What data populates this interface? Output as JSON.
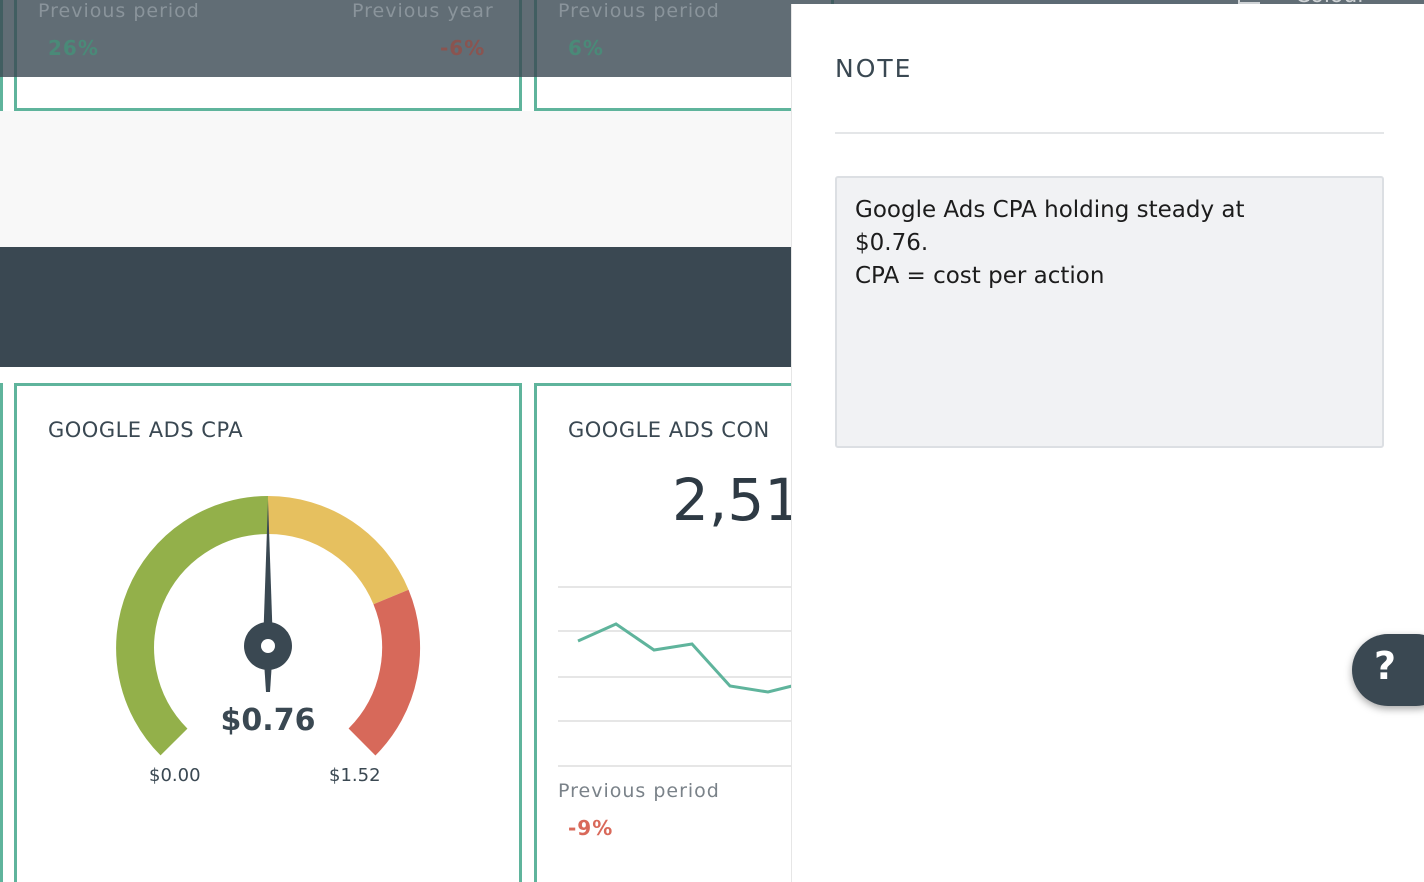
{
  "top_row": {
    "widget_a": {
      "previous_period_label": "Previous period",
      "previous_period_value": "26%",
      "previous_year_label": "Previous year",
      "previous_year_value": "-6%"
    },
    "widget_b": {
      "previous_period_label": "Previous period",
      "previous_period_value": "6%"
    },
    "toolbar_text": "Colour"
  },
  "cpa_widget": {
    "title": "GOOGLE ADS CPA",
    "value": "$0.76",
    "min": "$0.00",
    "max": "$1.52",
    "gauge": {
      "value": 0.76,
      "min": 0.0,
      "max": 1.52
    }
  },
  "conversions_widget": {
    "title": "GOOGLE ADS CON",
    "big_value": "2,51",
    "previous_period_label": "Previous period",
    "previous_period_value": "-9%"
  },
  "note_panel": {
    "heading": "NOTE",
    "text": "Google Ads CPA holding steady at\n$0.76.\nCPA = cost per action"
  },
  "help_button": {
    "label": "?"
  },
  "colors": {
    "accent": "#5fb49c",
    "dark": "#3a4852",
    "negative": "#d9695a",
    "gauge_green": "#93b04a",
    "gauge_yellow": "#e6c05f",
    "gauge_red": "#d7695a"
  }
}
